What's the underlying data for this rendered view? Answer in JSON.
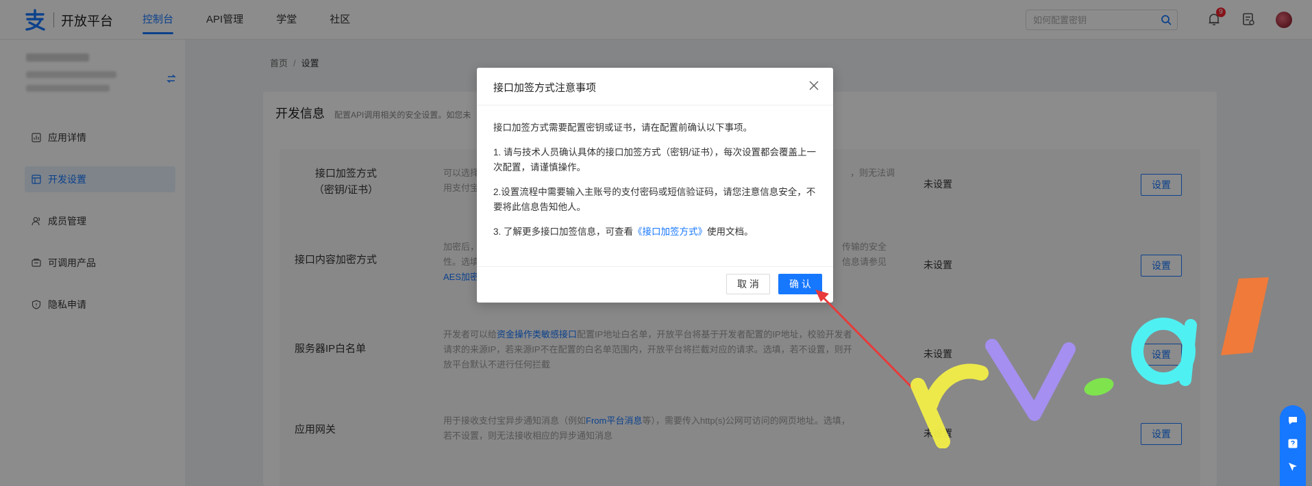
{
  "topbar": {
    "brand": "开放平台",
    "nav": [
      "控制台",
      "API管理",
      "学堂",
      "社区"
    ],
    "search_placeholder": "如何配置密钥",
    "notification_count": "9",
    "accent": "#1677ff"
  },
  "sidebar": {
    "menu": [
      "应用详情",
      "开发设置",
      "成员管理",
      "可调用产品",
      "隐私申请"
    ]
  },
  "breadcrumb": {
    "home": "首页",
    "sep": "/",
    "current": "设置"
  },
  "card": {
    "title": "开发信息",
    "desc": "配置API调用相关的安全设置。如您未",
    "rows": [
      {
        "name_l1": "接口加签方式",
        "name_l2": "（密钥/证书）",
        "desc": "可以选择",
        "desc_l2": "用支付宝",
        "desc_right": "，则无法调",
        "status": "未设置",
        "btn": "设置"
      },
      {
        "name_l1": "接口内容加密方式",
        "desc": "加密后，",
        "desc_l2": "性。选填",
        "desc_link": "AES加密",
        "desc_right": "传输的安全",
        "desc_right2": "信息请参见",
        "status": "未设置",
        "btn": "设置"
      },
      {
        "name_l1": "服务器IP白名单",
        "desc_a": "开发者可以给",
        "desc_link": "资金操作类敏感接口",
        "desc_b": "配置IP地址白名单，开放平台将基于开发者配置的IP地址，校验开发者",
        "desc_l2": "请求的来源IP，若来源IP不在配置的白名单范围内，开放平台将拦截对应的请求。选填，若不设置，则开",
        "desc_l3": "放平台默认不进行任何拦截",
        "status": "未设置",
        "btn": "设置"
      },
      {
        "name_l1": "应用网关",
        "desc_a": "用于接收支付宝异步通知消息（例如",
        "desc_link": "From平台消息",
        "desc_b": "等），需要传入http(s)公网可访问的网页地址。选填，",
        "desc_l2": "若不设置，则无法接收相应的异步通知消息",
        "status": "未设置",
        "btn": "设置"
      }
    ]
  },
  "modal": {
    "title": "接口加签方式注意事项",
    "intro": "接口加签方式需要配置密钥或证书，请在配置前确认以下事项。",
    "item1": "1. 请与技术人员确认具体的接口加签方式（密钥/证书），每次设置都会覆盖上一次配置，请谨慎操作。",
    "item2": "2.设置流程中需要输入主账号的支付密码或短信验证码，请您注意信息安全，不要将此信息告知他人。",
    "item3_a": "3. 了解更多接口加签信息，可查看",
    "item3_link": "《接口加签方式》",
    "item3_b": "使用文档。",
    "cancel": "取 消",
    "ok": "确 认"
  },
  "watermark": "rv.al"
}
